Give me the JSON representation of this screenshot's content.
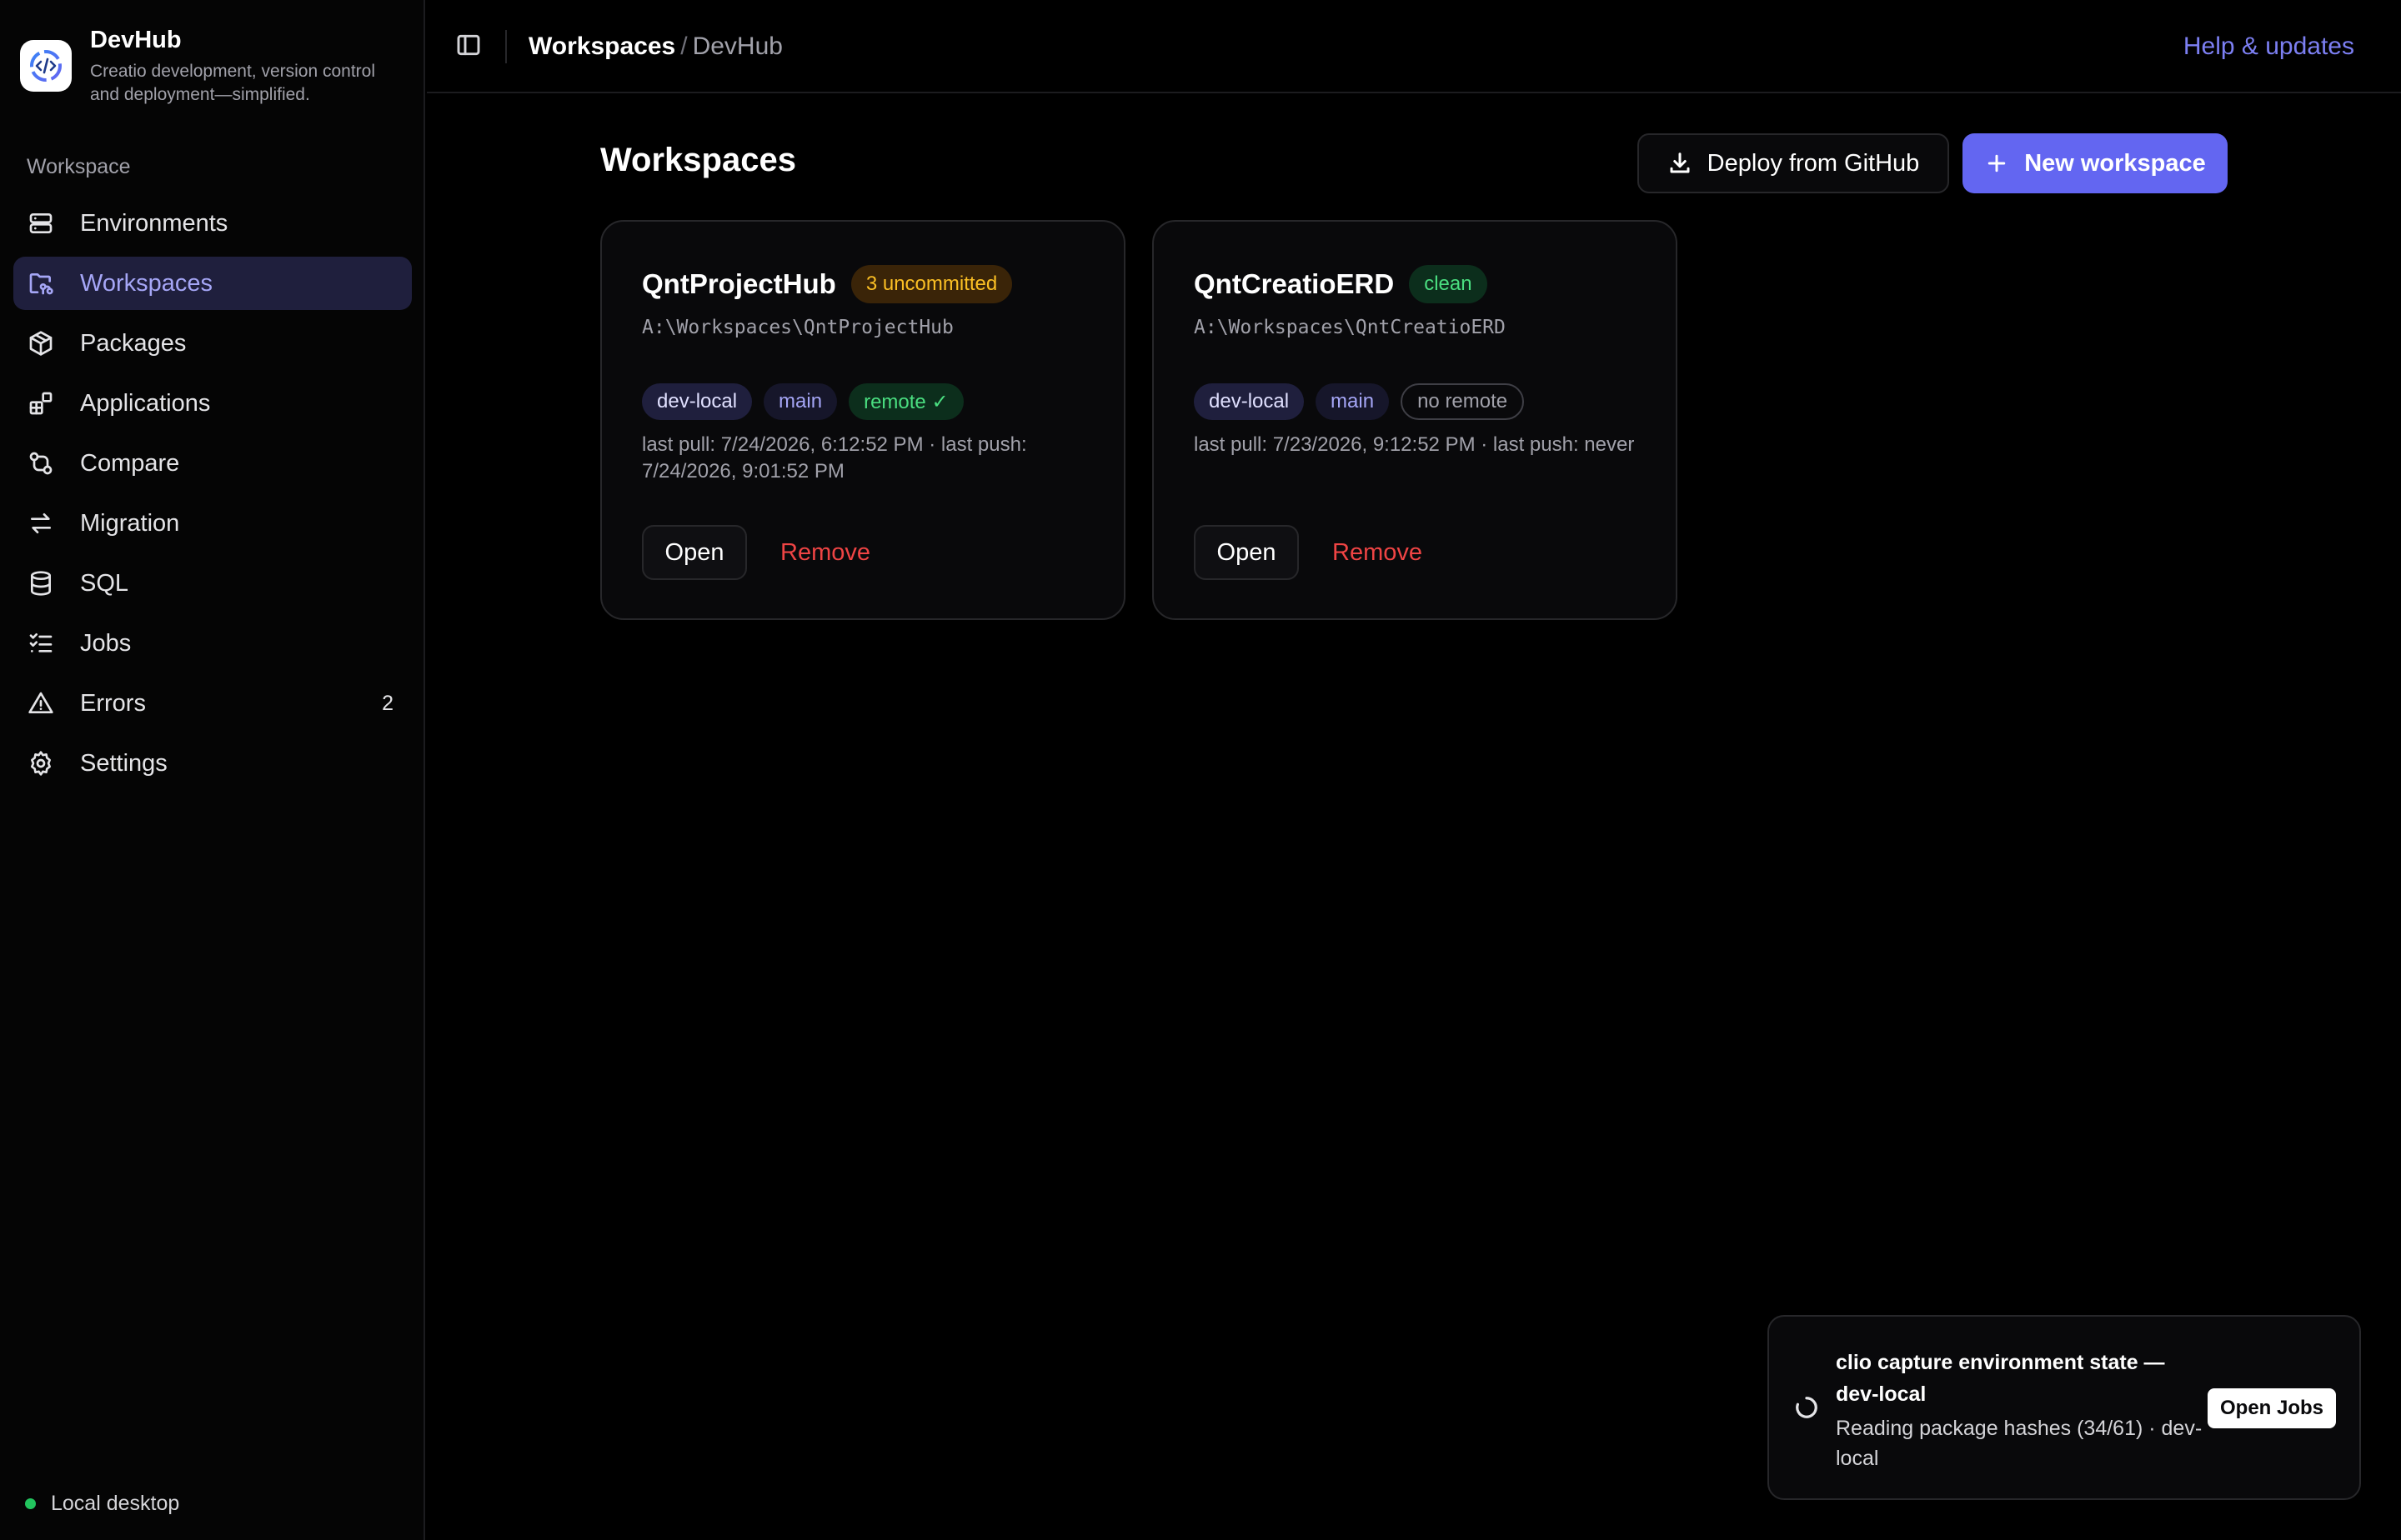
{
  "brand": {
    "name": "DevHub",
    "tagline": "Creatio development, version control and deployment—simplified."
  },
  "sidebar": {
    "section_label": "Workspace",
    "items": [
      {
        "label": "Environments",
        "icon": "server-icon"
      },
      {
        "label": "Workspaces",
        "icon": "folder-git-icon",
        "active": true
      },
      {
        "label": "Packages",
        "icon": "package-icon"
      },
      {
        "label": "Applications",
        "icon": "apps-icon"
      },
      {
        "label": "Compare",
        "icon": "git-compare-icon"
      },
      {
        "label": "Migration",
        "icon": "arrows-swap-icon"
      },
      {
        "label": "SQL",
        "icon": "database-icon"
      },
      {
        "label": "Jobs",
        "icon": "list-checks-icon"
      },
      {
        "label": "Errors",
        "icon": "warning-triangle-icon",
        "count": "2"
      },
      {
        "label": "Settings",
        "icon": "gear-icon"
      }
    ],
    "footer_status": "Local desktop"
  },
  "topbar": {
    "breadcrumb_current": "Workspaces",
    "breadcrumb_separator": "/",
    "breadcrumb_sub": "DevHub",
    "help_link": "Help & updates"
  },
  "main": {
    "title": "Workspaces",
    "deploy_button": "Deploy from GitHub",
    "new_button": "New workspace",
    "cards": [
      {
        "name": "QntProjectHub",
        "state": "3 uncommitted",
        "path": "A:\\Workspaces\\QntProjectHub",
        "env": "dev-local",
        "branch": "main",
        "remote": "remote ✓",
        "meta": "last pull: 7/24/2026, 6:12:52 PM · last push: 7/24/2026, 9:01:52 PM",
        "open_label": "Open",
        "remove_label": "Remove"
      },
      {
        "name": "QntCreatioERD",
        "state": "clean",
        "path": "A:\\Workspaces\\QntCreatioERD",
        "env": "dev-local",
        "branch": "main",
        "remote": "no remote",
        "meta": "last pull: 7/23/2026, 9:12:52 PM · last push: never",
        "open_label": "Open",
        "remove_label": "Remove"
      }
    ]
  },
  "toast": {
    "title": "clio capture environment state — dev-local",
    "body": "Reading package hashes (34/61) · dev-local",
    "button": "Open Jobs"
  },
  "colors": {
    "accent": "#6366f1",
    "active_nav_bg": "#1f1f3d",
    "warn": "#fbbf24",
    "ok": "#4ade80",
    "danger": "#ef4444"
  }
}
